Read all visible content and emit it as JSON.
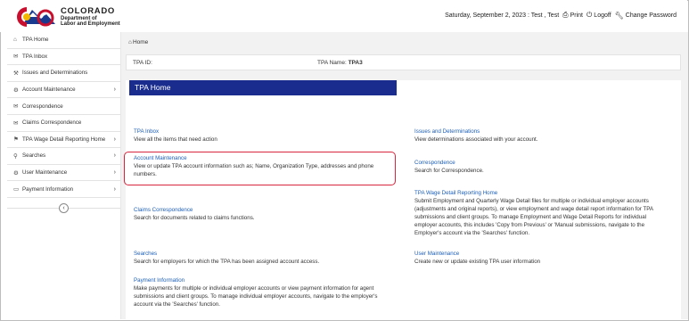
{
  "brand": {
    "title": "COLORADO",
    "subtitle_line1": "Department of",
    "subtitle_line2": "Labor and Employment",
    "colors": {
      "red": "#c8102e",
      "blue": "#1a3a8f",
      "gold": "#f2b700"
    }
  },
  "header": {
    "date_user": "Saturday, September 2, 2023 : Test , Test",
    "print_label": "Print",
    "print_icon": "print-icon",
    "logoff_label": "Logoff",
    "logoff_icon": "power-icon",
    "change_password_label": "Change Password",
    "change_password_icon": "wrench-icon"
  },
  "sidebar": {
    "items": [
      {
        "label": "TPA Home",
        "icon": "home-icon",
        "glyph": "⌂",
        "has_submenu": false
      },
      {
        "label": "TPA Inbox",
        "icon": "envelope-icon",
        "glyph": "✉",
        "has_submenu": false
      },
      {
        "label": "Issues and Determinations",
        "icon": "wrench-icon",
        "glyph": "⚒",
        "has_submenu": false
      },
      {
        "label": "Account Maintenance",
        "icon": "gears-icon",
        "glyph": "⚙",
        "has_submenu": true
      },
      {
        "label": "Correspondence",
        "icon": "envelope-icon",
        "glyph": "✉",
        "has_submenu": false
      },
      {
        "label": "Claims Correspondence",
        "icon": "envelope-icon",
        "glyph": "✉",
        "has_submenu": false
      },
      {
        "label": "TPA Wage Detail Reporting Home",
        "icon": "flag-icon",
        "glyph": "⚑",
        "has_submenu": true
      },
      {
        "label": "Searches",
        "icon": "search-icon",
        "glyph": "⚲",
        "has_submenu": true
      },
      {
        "label": "User Maintenance",
        "icon": "gears-icon",
        "glyph": "⚙",
        "has_submenu": true
      },
      {
        "label": "Payment Information",
        "icon": "card-icon",
        "glyph": "▭",
        "has_submenu": true
      }
    ],
    "collapse_glyph": "‹"
  },
  "breadcrumb": {
    "label": "Home",
    "icon": "home-icon"
  },
  "tpa_bar": {
    "id_label": "TPA ID:",
    "name_label": "TPA Name:",
    "name_value": "TPA3"
  },
  "main": {
    "title": "TPA Home",
    "title_bar_color": "#1a2d8f",
    "link_color": "#1d5fb8",
    "highlight_color": "#d7263d",
    "tiles": {
      "inbox": {
        "title": "TPA Inbox",
        "desc": "View all the items that need action"
      },
      "account": {
        "title": "Account Maintenance",
        "desc_line1": "View or update TPA account information such as; Name, Organization Type, addresses and phone",
        "desc_line2": "numbers."
      },
      "claims": {
        "title": "Claims Correspondence",
        "desc": "Search for documents related to claims functions."
      },
      "searches": {
        "title": "Searches",
        "desc": "Search for employers for which the TPA has been assigned account access."
      },
      "payment": {
        "title": "Payment Information",
        "desc_line1": "Make payments for multiple or individual employer accounts or view payment information for agent",
        "desc_line2": "submissions and client groups. To manage individual employer accounts, navigate to the employer's",
        "desc_line3": "account via the 'Searches' function."
      },
      "issues": {
        "title": "Issues and Determinations",
        "desc": "View determinations associated with your account."
      },
      "correspondence": {
        "title": "Correspondence",
        "desc": "Search for Correspondence."
      },
      "wage": {
        "title": "TPA Wage Detail Reporting Home",
        "desc_line1": "Submit Employment and Quarterly Wage Detail files for multiple or individual employer accounts",
        "desc_line2": "(adjustments and original reports), or view employment and wage detail report information for TPA",
        "desc_line3": "submissions and client groups. To manage Employment and Wage Detail Reports for individual",
        "desc_line4": "employer accounts, this includes 'Copy from Previous' or 'Manual submissions, navigate to the",
        "desc_line5": "Employer's account via the 'Searches' function."
      },
      "user": {
        "title": "User Maintenance",
        "desc": "Create new or update existing TPA user information"
      }
    }
  }
}
